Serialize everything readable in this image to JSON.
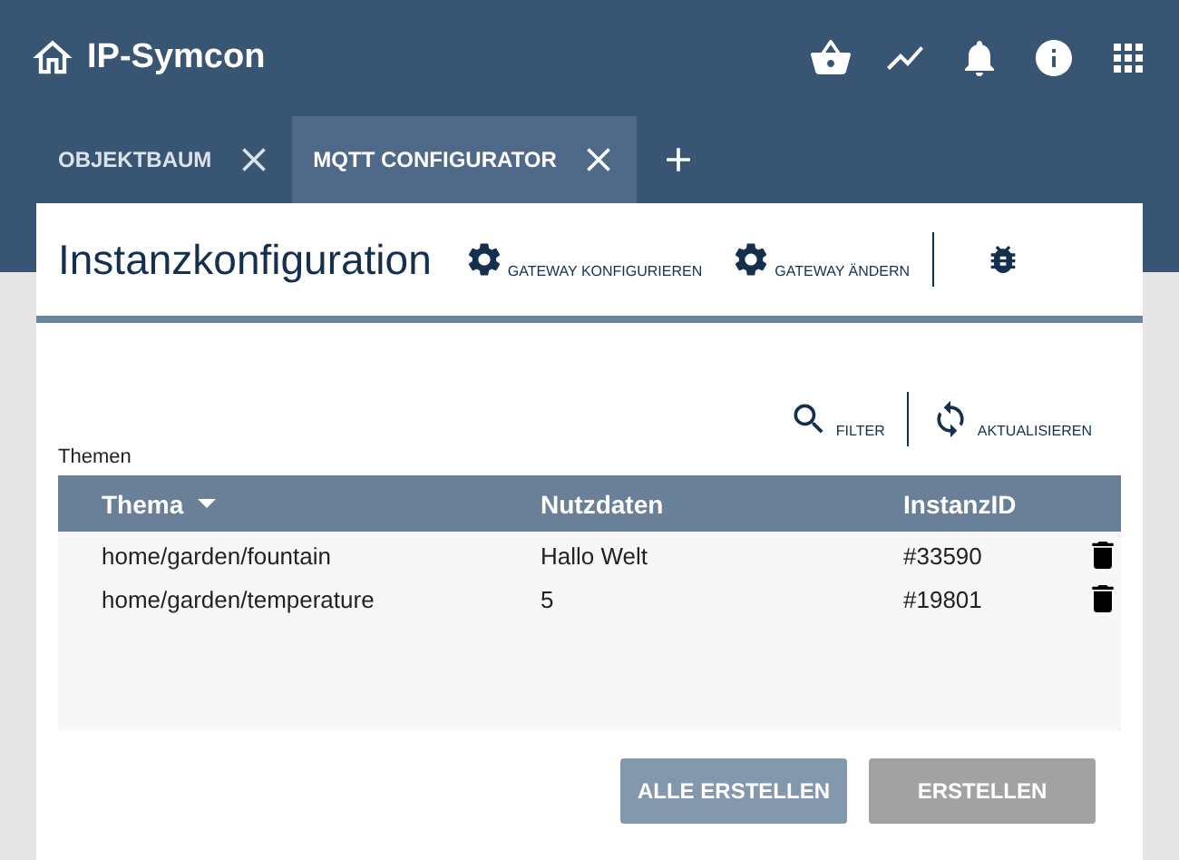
{
  "app": {
    "title": "IP-Symcon"
  },
  "tabs": [
    {
      "label": "OBJEKTBAUM",
      "selected": false
    },
    {
      "label": "MQTT CONFIGURATOR",
      "selected": true
    }
  ],
  "panel": {
    "title": "Instanzkonfiguration",
    "actions": [
      {
        "label": "GATEWAY KONFIGURIEREN"
      },
      {
        "label": "GATEWAY ÄNDERN"
      }
    ]
  },
  "list": {
    "label": "Themen",
    "tools": [
      {
        "kind": "filter",
        "label": "FILTER"
      },
      {
        "kind": "refresh",
        "label": "AKTUALISIEREN"
      }
    ],
    "columns": [
      {
        "label": "Thema",
        "sorted": true
      },
      {
        "label": "Nutzdaten",
        "sorted": false
      },
      {
        "label": "InstanzID",
        "sorted": false
      }
    ],
    "rows": [
      {
        "cells": [
          "home/garden/fountain",
          "Hallo Welt",
          "#33590"
        ]
      },
      {
        "cells": [
          "home/garden/temperature",
          "5",
          "#19801"
        ]
      }
    ]
  },
  "buttons": [
    {
      "label": "ALLE ERSTELLEN",
      "disabled": false
    },
    {
      "label": "ERSTELLEN",
      "disabled": true
    }
  ]
}
